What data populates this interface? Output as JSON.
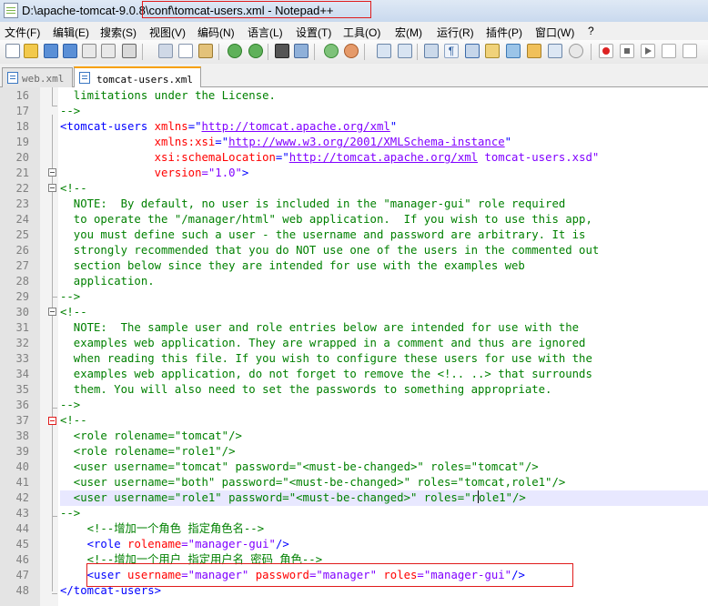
{
  "window": {
    "title_path_start": "D:\\apache-tomcat-9.0.8\\",
    "title_rest": "conf\\tomcat-users.xml - Notepad++"
  },
  "menu": [
    "文件(F)",
    "编辑(E)",
    "搜索(S)",
    "视图(V)",
    "编码(N)",
    "语言(L)",
    "设置(T)",
    "工具(O)",
    "宏(M)",
    "运行(R)",
    "插件(P)",
    "窗口(W)",
    "?"
  ],
  "toolbar_icons": [
    "new-file-icon",
    "open-file-icon",
    "save-icon",
    "save-all-icon",
    "close-icon",
    "close-all-icon",
    "print-icon",
    "cut-icon",
    "copy-icon",
    "paste-icon",
    "undo-icon",
    "redo-icon",
    "find-icon",
    "replace-icon",
    "zoom-in-icon",
    "zoom-out-icon",
    "sync-vertical-icon",
    "sync-horizontal-icon",
    "word-wrap-icon",
    "show-all-chars-icon",
    "indent-guide-icon",
    "user-language-icon",
    "doc-map-icon",
    "function-list-icon",
    "monitor-icon",
    "record-macro-icon",
    "stop-record-icon",
    "play-macro-icon",
    "run-macro-icon",
    "save-macro-icon"
  ],
  "tabs": [
    {
      "label": "web.xml",
      "active": false
    },
    {
      "label": "tomcat-users.xml",
      "active": true
    }
  ],
  "editor": {
    "line_numbers": [
      "16",
      "17",
      "18",
      "19",
      "20",
      "21",
      "22",
      "23",
      "24",
      "25",
      "26",
      "27",
      "28",
      "29",
      "30",
      "31",
      "32",
      "33",
      "34",
      "35",
      "36",
      "37",
      "38",
      "39",
      "40",
      "41",
      "42",
      "43",
      "44",
      "45",
      "46",
      "47",
      "48"
    ],
    "l16": "  limitations under the License.",
    "l17": "-->",
    "l18": [
      "<tomcat-users ",
      "xmlns",
      "=\"",
      "http://tomcat.apache.org/xml",
      "\""
    ],
    "l19": [
      "              ",
      "xmlns:xsi",
      "=\"",
      "http://www.w3.org/2001/XMLSchema-instance",
      "\""
    ],
    "l20a": "              ",
    "l20b": "xsi:schemaLocation",
    "l20c": "=\"",
    "l20d": "http://tomcat.apache.org/xml",
    "l20e": " tomcat-users.xsd\"",
    "l21": [
      "              ",
      "version",
      "=\"1.0\"",
      ">"
    ],
    "l22": "<!--",
    "l23": "  NOTE:  By default, no user is included in the \"manager-gui\" role required",
    "l24": "  to operate the \"/manager/html\" web application.  If you wish to use this app,",
    "l25": "  you must define such a user - the username and password are arbitrary. It is",
    "l26": "  strongly recommended that you do NOT use one of the users in the commented out",
    "l27": "  section below since they are intended for use with the examples web",
    "l28": "  application.",
    "l29": "-->",
    "l30": "<!--",
    "l31": "  NOTE:  The sample user and role entries below are intended for use with the",
    "l32": "  examples web application. They are wrapped in a comment and thus are ignored",
    "l33": "  when reading this file. If you wish to configure these users for use with the",
    "l34": "  examples web application, do not forget to remove the <!.. ..> that surrounds",
    "l35": "  them. You will also need to set the passwords to something appropriate.",
    "l36": "-->",
    "l37": "<!--",
    "l38": "  <role rolename=\"tomcat\"/>",
    "l39": "  <role rolename=\"role1\"/>",
    "l40": "  <user username=\"tomcat\" password=\"<must-be-changed>\" roles=\"tomcat\"/>",
    "l41": "  <user username=\"both\" password=\"<must-be-changed>\" roles=\"tomcat,role1\"/>",
    "l42a": "  <user username=\"role1\" password=\"<must-be-changed>\" roles=\"r",
    "l42b": "ole1\"/>",
    "l43": "-->",
    "l44": "    <!--增加一个角色 指定角色名-->",
    "l45": [
      "    ",
      "<role ",
      "rolename",
      "=\"manager-gui\"",
      "/>"
    ],
    "l46": "    <!--增加一个用户 指定用户名 密码 角色-->",
    "l47": [
      "    ",
      "<user ",
      "username",
      "=\"manager\" ",
      "password",
      "=\"manager\" ",
      "roles",
      "=\"manager-gui\"",
      "/>"
    ],
    "l48": "</tomcat-users>"
  },
  "colors": {
    "tag": "#0000ff",
    "attribute": "#ff0000",
    "value": "#8000ff",
    "comment": "#008000",
    "annotation": "#e01b1b",
    "current_line": "#e8e8ff"
  }
}
